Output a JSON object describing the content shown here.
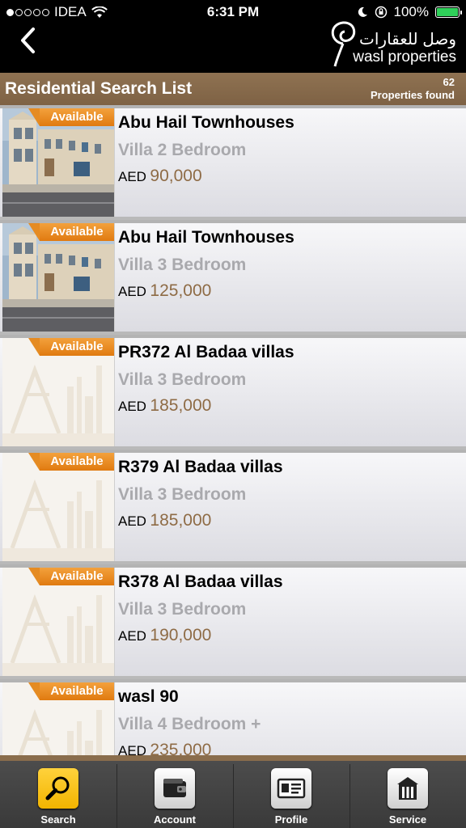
{
  "status": {
    "carrier": "IDEA",
    "time": "6:31 PM",
    "battery": "100%"
  },
  "nav": {
    "logo_arabic": "وصل للعقارات",
    "logo_english": "wasl properties"
  },
  "header": {
    "title": "Residential Search List",
    "count": "62",
    "count_label": "Properties found"
  },
  "listings": [
    {
      "name": "Abu Hail Townhouses",
      "type": "Villa 2 Bedroom",
      "currency": "AED",
      "price": "90,000",
      "badge": "Available",
      "photo": "townhouse"
    },
    {
      "name": "Abu Hail Townhouses",
      "type": "Villa 3 Bedroom",
      "currency": "AED",
      "price": "125,000",
      "badge": "Available",
      "photo": "townhouse"
    },
    {
      "name": "PR372 Al Badaa villas",
      "type": "Villa 3 Bedroom",
      "currency": "AED",
      "price": "185,000",
      "badge": "Available",
      "photo": "placeholder"
    },
    {
      "name": "R379 Al Badaa villas",
      "type": "Villa 3 Bedroom",
      "currency": "AED",
      "price": "185,000",
      "badge": "Available",
      "photo": "placeholder"
    },
    {
      "name": "R378 Al Badaa villas",
      "type": "Villa 3 Bedroom",
      "currency": "AED",
      "price": "190,000",
      "badge": "Available",
      "photo": "placeholder"
    },
    {
      "name": "wasl 90",
      "type": "Villa 4 Bedroom +",
      "currency": "AED",
      "price": "235,000",
      "badge": "Available",
      "photo": "placeholder"
    }
  ],
  "tabs": [
    {
      "label": "Search",
      "icon": "search-icon",
      "active": true
    },
    {
      "label": "Account",
      "icon": "wallet-icon",
      "active": false
    },
    {
      "label": "Profile",
      "icon": "id-card-icon",
      "active": false
    },
    {
      "label": "Service",
      "icon": "tools-icon",
      "active": false
    }
  ],
  "colors": {
    "accent_brown": "#8e6b45",
    "badge_orange": "#e07a10",
    "active_tab": "#f2b400"
  }
}
